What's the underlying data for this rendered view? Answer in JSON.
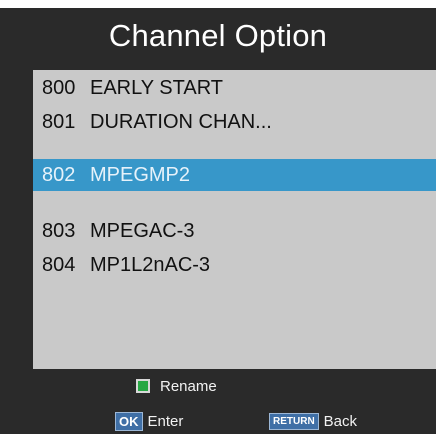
{
  "dialog": {
    "title": "Channel Option"
  },
  "channels": [
    {
      "number": "800",
      "name": "EARLY START",
      "selected": false
    },
    {
      "number": "801",
      "name": "DURATION CHAN...",
      "selected": false
    },
    {
      "number": "802",
      "name": "MPEGMP2",
      "selected": true
    },
    {
      "number": "803",
      "name": "MPEGAC-3",
      "selected": false
    },
    {
      "number": "804",
      "name": "MP1L2nAC-3",
      "selected": false
    }
  ],
  "footer": {
    "rename_label": "Rename",
    "ok_key": "OK",
    "ok_label": "Enter",
    "return_key": "RETURN",
    "return_label": "Back"
  },
  "colors": {
    "panel_background": "#2a2a2a",
    "list_background": "#c9c9c9",
    "selected_row": "#3797c9",
    "rename_key": "#27a744",
    "key_badge": "#3f6fa6"
  }
}
